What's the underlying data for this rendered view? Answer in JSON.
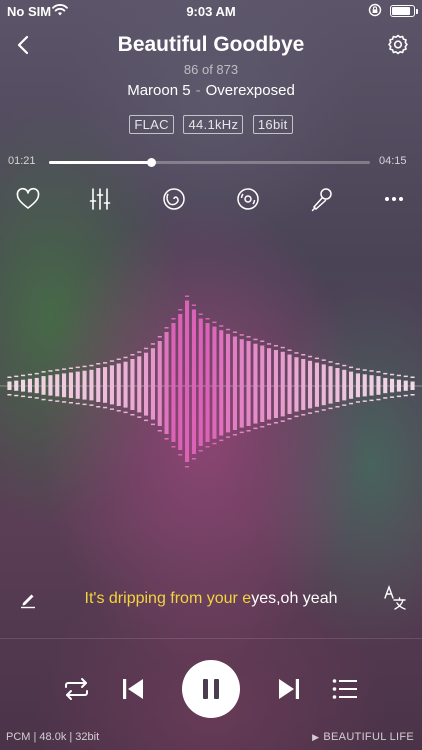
{
  "status_bar": {
    "carrier": "No SIM",
    "time": "9:03 AM",
    "battery_level": 0.85,
    "icons": [
      "wifi-icon",
      "rotation-lock-icon",
      "battery-icon"
    ]
  },
  "header": {
    "title": "Beautiful Goodbye",
    "track_position": "86 of 873",
    "artist": "Maroon 5",
    "separator": "-",
    "album": "Overexposed",
    "icons": [
      "back-chevron-icon",
      "gear-icon"
    ]
  },
  "format_badges": [
    "FLAC",
    "44.1kHz",
    "16bit"
  ],
  "progress": {
    "elapsed": "01:21",
    "total": "04:15",
    "fraction": 0.318
  },
  "actions": [
    "heart-icon",
    "equalizer-icon",
    "spiral-effect-icon",
    "disc-icon",
    "microphone-icon",
    "more-dots-icon"
  ],
  "lyrics": {
    "sung": "It's dripping from your e",
    "unsung": "yes,oh yeah",
    "icons": [
      "edit-pencil-icon",
      "translate-icon"
    ]
  },
  "controls": {
    "icons": [
      "repeat-icon",
      "previous-icon",
      "pause-icon",
      "next-icon",
      "queue-list-icon"
    ]
  },
  "footer": {
    "audio_info": "PCM | 48.0k | 32bit",
    "playlist": "BEAUTIFUL LIFE"
  },
  "waveform": {
    "levels": [
      0.05,
      0.06,
      0.07,
      0.08,
      0.09,
      0.11,
      0.12,
      0.13,
      0.14,
      0.15,
      0.16,
      0.17,
      0.18,
      0.2,
      0.21,
      0.23,
      0.25,
      0.27,
      0.3,
      0.33,
      0.37,
      0.42,
      0.5,
      0.6,
      0.7,
      0.8,
      0.95,
      0.85,
      0.75,
      0.7,
      0.66,
      0.62,
      0.58,
      0.55,
      0.52,
      0.5,
      0.47,
      0.45,
      0.42,
      0.4,
      0.38,
      0.35,
      0.32,
      0.3,
      0.28,
      0.26,
      0.24,
      0.22,
      0.2,
      0.18,
      0.16,
      0.14,
      0.13,
      0.12,
      0.11,
      0.09,
      0.08,
      0.07,
      0.06,
      0.05
    ],
    "colors": {
      "low": "#f4e4ea",
      "high": "#dc62b8"
    }
  },
  "accent": {
    "lyric_highlight": "#f3d43c"
  }
}
